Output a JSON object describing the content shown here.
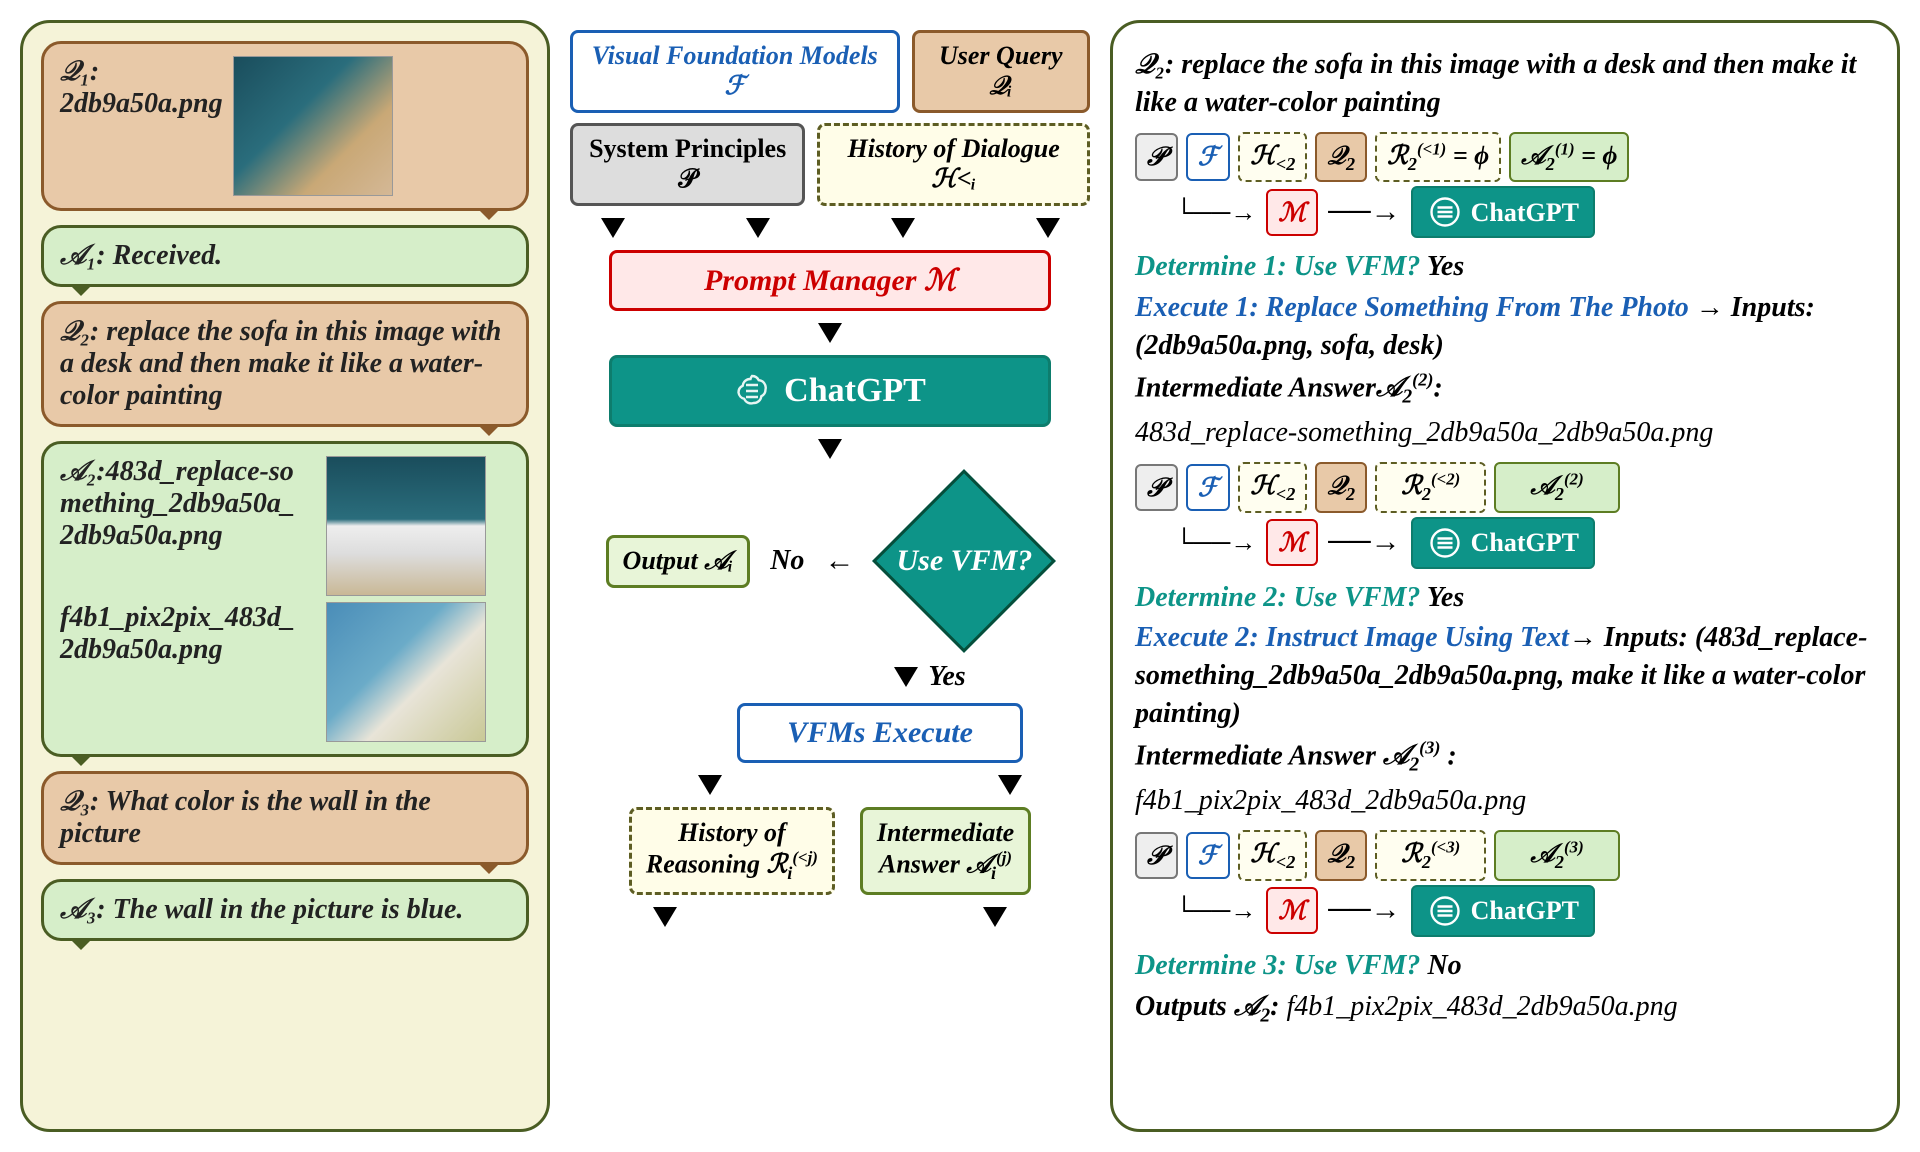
{
  "left": {
    "q1_label": "𝒬₁:",
    "q1_file": "2db9a50a.png",
    "a1": "𝒜₁: Received.",
    "q2": "𝒬₂: replace the sofa in this image with a desk and then make it like a water-color painting",
    "a2_label": "𝒜₂:",
    "a2_file1": "483d_replace-something_2db9a50a_2db9a50a.png",
    "a2_file2": "f4b1_pix2pix_483d_2db9a50a.png",
    "q3": "𝒬₃: What color is the wall in the picture",
    "a3": "𝒜₃: The wall in the picture is blue."
  },
  "center": {
    "vfm": "Visual Foundation Models ℱ",
    "uq": "User Query 𝒬ᵢ",
    "sp": "System Principles 𝒫",
    "hd": "History of Dialogue ℋ<ᵢ",
    "pm": "Prompt  Manager ℳ",
    "gpt": "ChatGPT",
    "decision": "Use VFM?",
    "no": "No",
    "yes": "Yes",
    "out": "Output 𝒜ᵢ",
    "vfme": "VFMs Execute",
    "hr": "History of Reasoning ℛᵢ(<j)",
    "ia": "Intermediate Answer 𝒜ᵢ(j)"
  },
  "right": {
    "q2": "𝒬₂: replace the sofa in this image with a desk and then make it like a water-color painting",
    "tokens": {
      "p": "𝒫",
      "f": "ℱ",
      "h": "ℋ<₂",
      "q": "𝒬₂",
      "r1": "ℛ₂(<1) = ϕ",
      "a1": "𝒜₂(1) = ϕ",
      "r2": "ℛ₂(<2)",
      "a2": "𝒜₂(2)",
      "r3": "ℛ₂(<3)",
      "a3": "𝒜₂(3)",
      "m": "ℳ",
      "gpt": "ChatGPT"
    },
    "det1_label": "Determine 1",
    "det1_q": ": Use VFM?",
    "det1_a": " Yes",
    "exe1_label": "Execute 1",
    "exe1_body": ": Replace Something From The Photo",
    "exe1_arrow": " → ",
    "exe1_in": "Inputs: (2db9a50a.png, sofa, desk)",
    "ia1_label": "Intermediate Answer",
    "ia1_sym": "𝒜₂(2)",
    "ia1_colon": ":",
    "ia1_val": "483d_replace-something_2db9a50a_2db9a50a.png",
    "det2_label": "Determine 2",
    "det2_q": ": Use VFM?",
    "det2_a": " Yes",
    "exe2_label": "Execute 2",
    "exe2_body": ": Instruct Image Using Text",
    "exe2_arrow": "→ ",
    "exe2_in": "Inputs: (483d_replace-something_2db9a50a_2db9a50a.png, make it like a water-color painting)",
    "ia2_label": "Intermediate Answer ",
    "ia2_sym": "𝒜₂(3)",
    "ia2_colon": " :",
    "ia2_val": "f4b1_pix2pix_483d_2db9a50a.png",
    "det3_label": "Determine 3",
    "det3_q": ": Use VFM?",
    "det3_a": " No",
    "out_label": "Outputs ",
    "out_sym": "𝒜₂",
    "out_colon": ": ",
    "out_val": "f4b1_pix2pix_483d_2db9a50a.png"
  }
}
